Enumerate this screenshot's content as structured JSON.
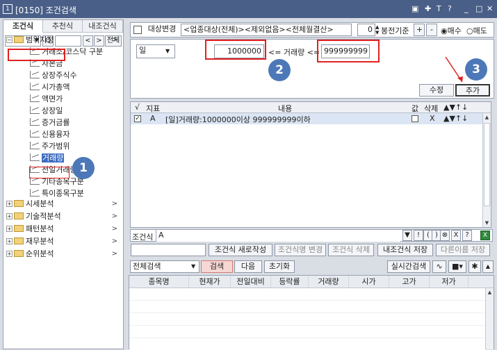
{
  "window": {
    "number": "1",
    "title": "[0150] 조건검색",
    "controls": [
      "▣",
      "𝔦",
      "T",
      "?",
      "_",
      "□",
      "✕"
    ]
  },
  "left": {
    "tabs": [
      "조건식",
      "추천식",
      "내조건식"
    ],
    "search_btn": "Q",
    "prev": "<",
    "next": ">",
    "all": "전체",
    "tree": [
      {
        "label": "범위지정",
        "level": 0,
        "type": "folder-open",
        "hl": true
      },
      {
        "label": "거래소/코스닥 구분",
        "level": 1
      },
      {
        "label": "자본금",
        "level": 1
      },
      {
        "label": "상장주식수",
        "level": 1
      },
      {
        "label": "시가총액",
        "level": 1
      },
      {
        "label": "액면가",
        "level": 1
      },
      {
        "label": "상장일",
        "level": 1
      },
      {
        "label": "증거금률",
        "level": 1
      },
      {
        "label": "신용융자",
        "level": 1
      },
      {
        "label": "주가범위",
        "level": 1
      },
      {
        "label": "거래량",
        "level": 1,
        "selected": true
      },
      {
        "label": "전일거래량",
        "level": 1
      },
      {
        "label": "기타종목구분",
        "level": 1
      },
      {
        "label": "특이종목구분",
        "level": 1
      },
      {
        "label": "시세분석",
        "level": 0,
        "type": "folder"
      },
      {
        "label": "기술적분석",
        "level": 0,
        "type": "folder"
      },
      {
        "label": "패턴분석",
        "level": 0,
        "type": "folder"
      },
      {
        "label": "재무분석",
        "level": 0,
        "type": "folder"
      },
      {
        "label": "순위분석",
        "level": 0,
        "type": "folder"
      }
    ]
  },
  "target": {
    "button": "대상변경",
    "text": "<업종대상(전체)><제외없음><전체월결산>",
    "offset": "0",
    "basis": "봉전기준",
    "plus": "+",
    "minus": "-",
    "buy": "매수",
    "sell": "매도"
  },
  "editor": {
    "period": "일",
    "min": "1000000",
    "label_left": "<= 거래량 <=",
    "max": "999999999",
    "edit": "수정",
    "add": "추가"
  },
  "cond_grid": {
    "headers": [
      "√",
      "지표",
      "내용",
      "값",
      "삭제",
      "▲▼↑↓"
    ],
    "rows": [
      {
        "check": "✓",
        "id": "A",
        "content": "[일]거래량:1000000이상 999999999이하",
        "del": "X",
        "ops": "▲▼↑↓"
      }
    ]
  },
  "formula": {
    "label": "조건식",
    "value": "A",
    "tools": [
      "▼",
      "!",
      "(",
      ")",
      "⊗",
      "X",
      "?"
    ]
  },
  "actions": {
    "new": "조건식 새로작성",
    "rename": "조건식명 변경",
    "delete": "조건식 삭제",
    "save": "내조건식 저장",
    "saveas": "다른이름 저장"
  },
  "search": {
    "scope": "전체검색",
    "search": "검색",
    "next": "다음",
    "reset": "초기화",
    "realtime": "실시간검색"
  },
  "results": {
    "columns": [
      "종목명",
      "현재가",
      "전일대비",
      "등락률",
      "거래량",
      "시가",
      "고가",
      "저가"
    ]
  },
  "steps": [
    "1",
    "2",
    "3"
  ]
}
